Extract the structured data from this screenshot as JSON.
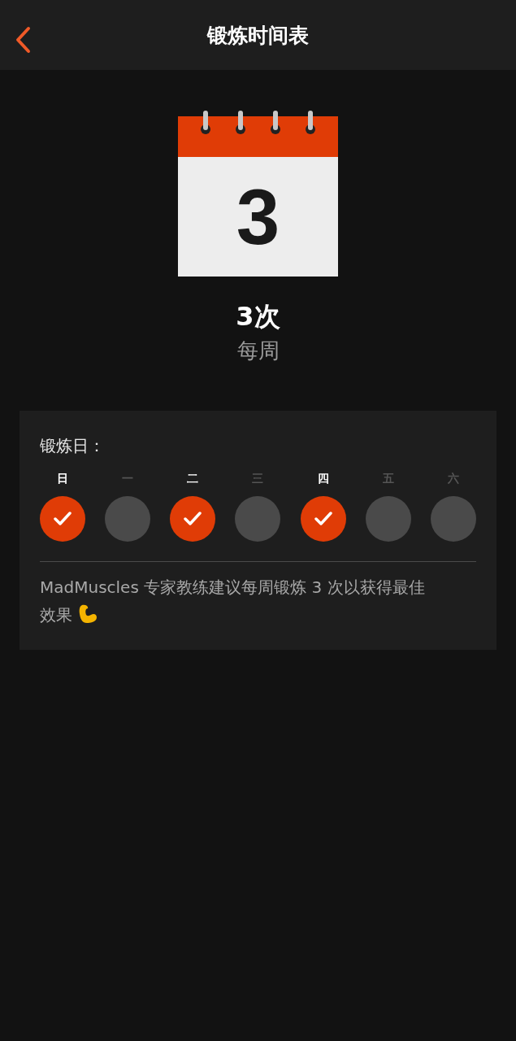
{
  "header": {
    "title": "锻炼时间表"
  },
  "calendar": {
    "number": "3"
  },
  "frequency": {
    "count": "3次",
    "period": "每周"
  },
  "schedule": {
    "label": "锻炼日：",
    "days": [
      {
        "label": "日",
        "selected": true
      },
      {
        "label": "一",
        "selected": false
      },
      {
        "label": "二",
        "selected": true
      },
      {
        "label": "三",
        "selected": false
      },
      {
        "label": "四",
        "selected": true
      },
      {
        "label": "五",
        "selected": false
      },
      {
        "label": "六",
        "selected": false
      }
    ],
    "note": "MadMuscles 专家教练建议每周锻炼 3 次以获得最佳效果"
  }
}
